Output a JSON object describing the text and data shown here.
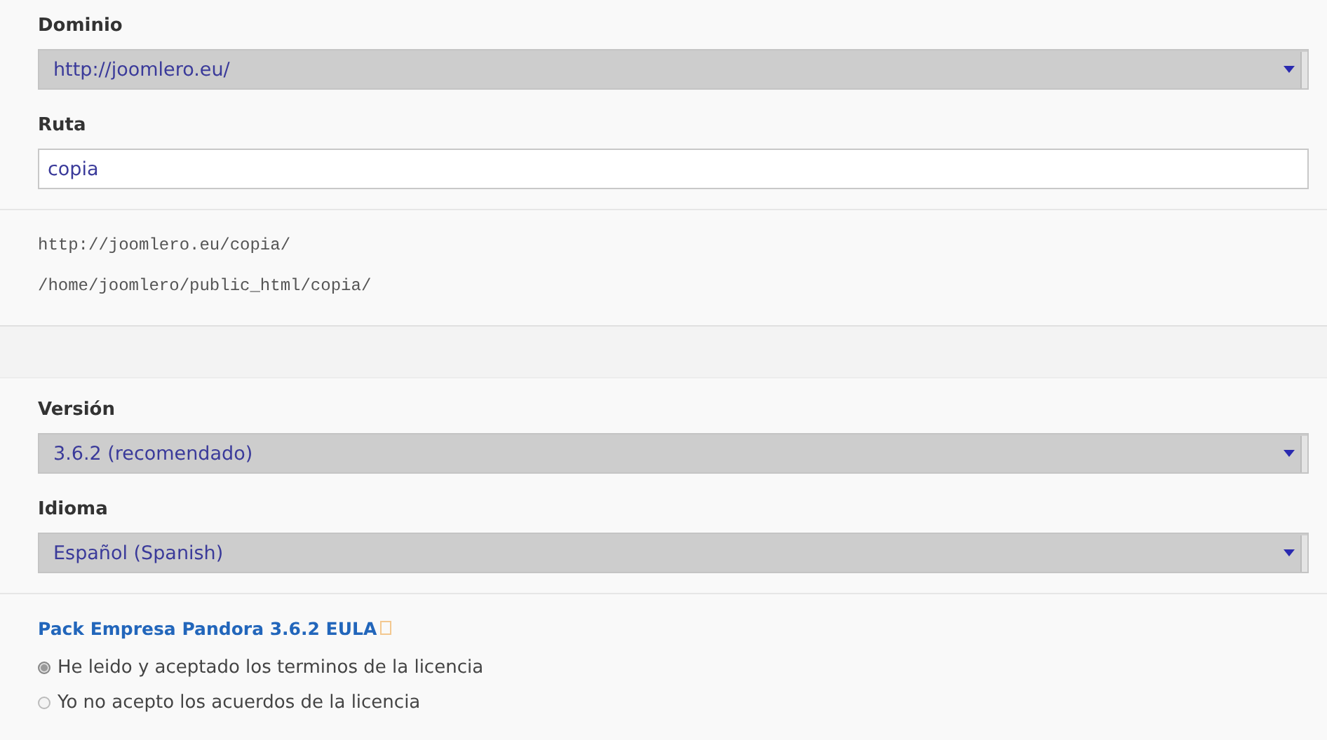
{
  "site_fields": [
    {
      "label": "Dominio",
      "kind": "select",
      "value": "http://joomlero.eu/"
    },
    {
      "label": "Ruta",
      "kind": "text",
      "value": "copia"
    }
  ],
  "paths": [
    "http://joomlero.eu/copia/",
    "/home/joomlero/public_html/copia/"
  ],
  "install_fields": [
    {
      "label": "Versión",
      "kind": "select",
      "value": "3.6.2 (recomendado)"
    },
    {
      "label": "Idioma",
      "kind": "select",
      "value": "Español (Spanish)"
    }
  ],
  "license": {
    "link": "Pack Empresa Pandora 3.6.2 EULA",
    "options": [
      {
        "label": "He leido y aceptado los terminos de la licencia",
        "selected": true
      },
      {
        "label": "Yo no acepto los acuerdos de la licencia",
        "selected": false
      }
    ]
  }
}
